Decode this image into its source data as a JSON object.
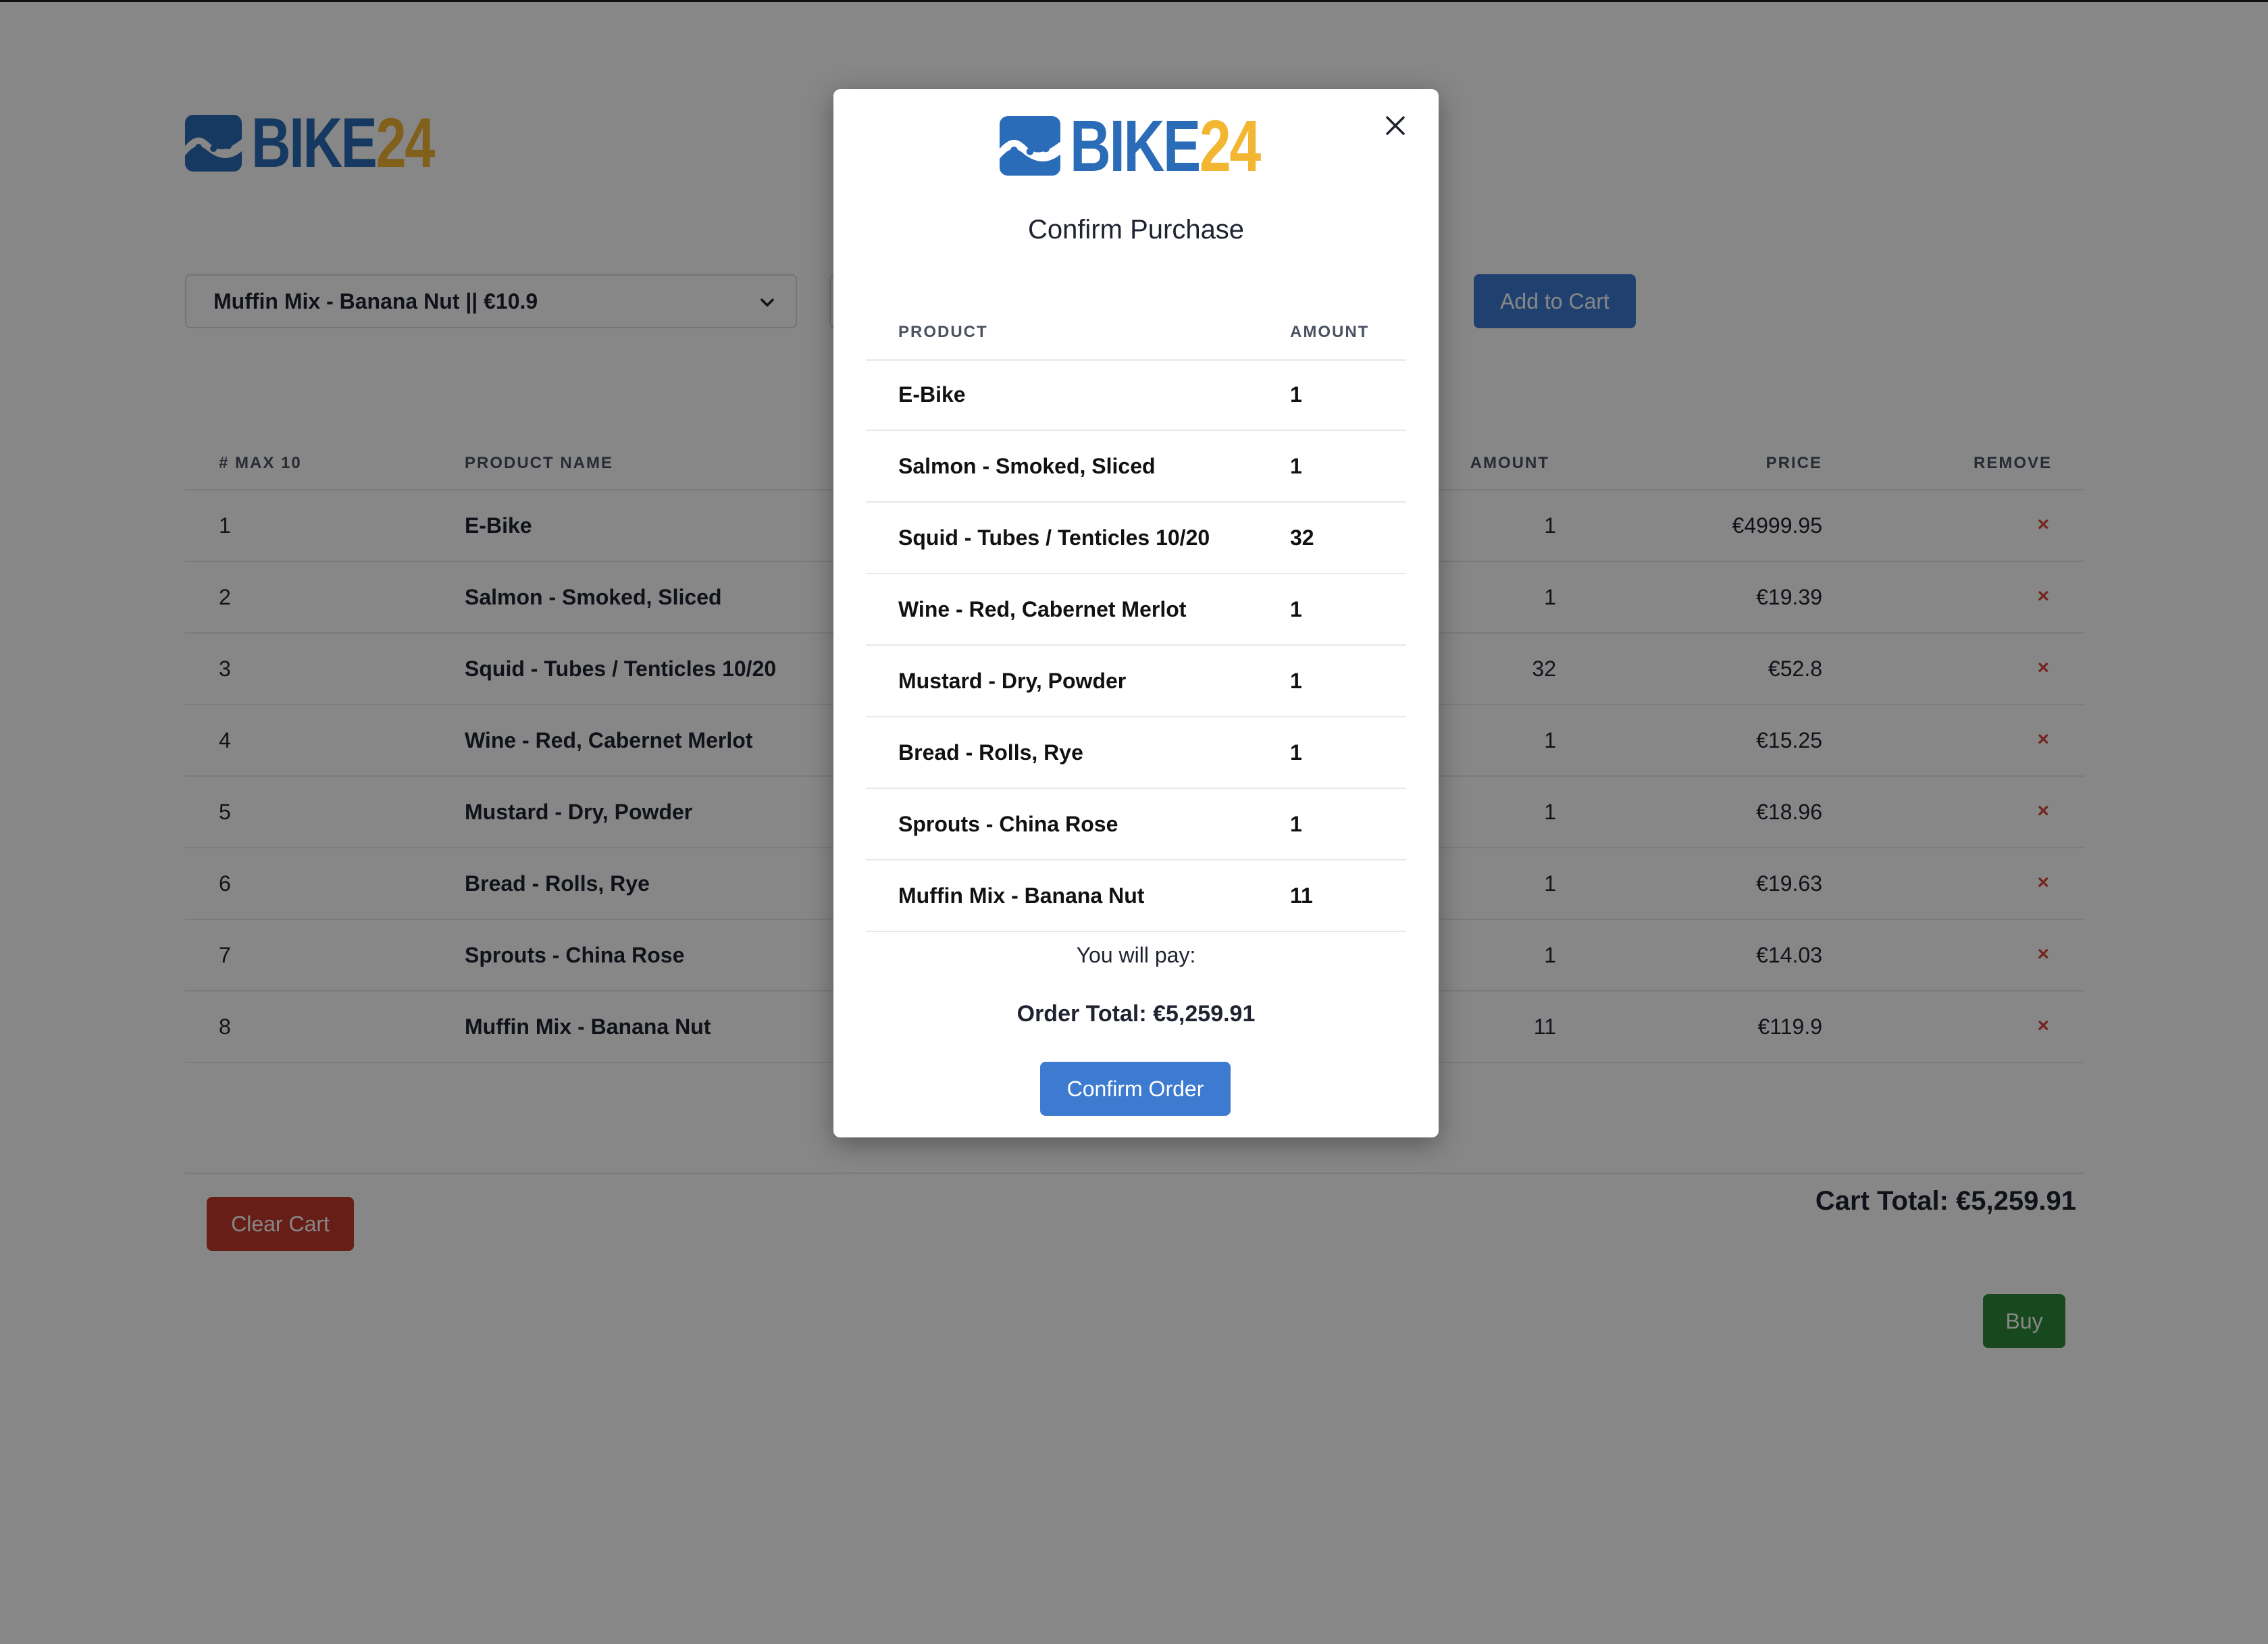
{
  "brand": {
    "word_blue": "BIKE",
    "word_gold": "24",
    "blue": "#2b6cb8",
    "gold": "#f2b632"
  },
  "controls": {
    "product_select_value": "Muffin Mix - Banana Nut || €10.9",
    "add_to_cart_label": "Add to Cart"
  },
  "cart": {
    "headers": {
      "idx": "# MAX 10",
      "name": "PRODUCT NAME",
      "amount": "AMOUNT",
      "price": "PRICE",
      "remove": "REMOVE"
    },
    "rows": [
      {
        "idx": "1",
        "name": "E-Bike",
        "amount": "1",
        "price": "€4999.95",
        "remove": "×"
      },
      {
        "idx": "2",
        "name": "Salmon - Smoked, Sliced",
        "amount": "1",
        "price": "€19.39",
        "remove": "×"
      },
      {
        "idx": "3",
        "name": "Squid - Tubes / Tenticles 10/20",
        "amount": "32",
        "price": "€52.8",
        "remove": "×"
      },
      {
        "idx": "4",
        "name": "Wine - Red, Cabernet Merlot",
        "amount": "1",
        "price": "€15.25",
        "remove": "×"
      },
      {
        "idx": "5",
        "name": "Mustard - Dry, Powder",
        "amount": "1",
        "price": "€18.96",
        "remove": "×"
      },
      {
        "idx": "6",
        "name": "Bread - Rolls, Rye",
        "amount": "1",
        "price": "€19.63",
        "remove": "×"
      },
      {
        "idx": "7",
        "name": "Sprouts - China Rose",
        "amount": "1",
        "price": "€14.03",
        "remove": "×"
      },
      {
        "idx": "8",
        "name": "Muffin Mix - Banana Nut",
        "amount": "11",
        "price": "€119.9",
        "remove": "×"
      }
    ],
    "clear_label": "Clear Cart",
    "total_label": "Cart Total: €5,259.91",
    "buy_label": "Buy"
  },
  "modal": {
    "title": "Confirm Purchase",
    "headers": {
      "product": "PRODUCT",
      "amount": "AMOUNT"
    },
    "rows": [
      {
        "name": "E-Bike",
        "amount": "1"
      },
      {
        "name": "Salmon - Smoked, Sliced",
        "amount": "1"
      },
      {
        "name": "Squid - Tubes / Tenticles 10/20",
        "amount": "32"
      },
      {
        "name": "Wine - Red, Cabernet Merlot",
        "amount": "1"
      },
      {
        "name": "Mustard - Dry, Powder",
        "amount": "1"
      },
      {
        "name": "Bread - Rolls, Rye",
        "amount": "1"
      },
      {
        "name": "Sprouts - China Rose",
        "amount": "1"
      },
      {
        "name": "Muffin Mix - Banana Nut",
        "amount": "11"
      }
    ],
    "pay_label": "You will pay:",
    "order_total": "Order Total: €5,259.91",
    "confirm_label": "Confirm Order",
    "close_icon": "close-icon"
  }
}
